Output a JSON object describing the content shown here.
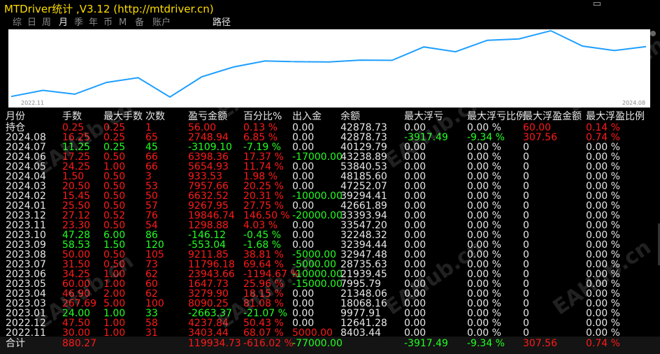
{
  "window": {
    "title": "MTDriver统计 ,V3.12 (http://mtdriver.cn)",
    "max_glyph": "▭"
  },
  "tabs": [
    {
      "label": "综"
    },
    {
      "label": "日"
    },
    {
      "label": "周"
    },
    {
      "label": "月"
    },
    {
      "label": "季"
    },
    {
      "label": "年"
    },
    {
      "label": "币"
    },
    {
      "label": "M"
    },
    {
      "label": "备"
    },
    {
      "label": "账户"
    }
  ],
  "active_tab": 3,
  "route_label": "路径",
  "chart": {
    "x_start": "2022.11",
    "x_end": "2024.08",
    "line_color": "#1e9fff",
    "values": [
      8403.44,
      12641.28,
      9977.91,
      18068.16,
      21348.06,
      7995.79,
      21939.45,
      28735.63,
      32947.48,
      32394.44,
      32248.32,
      33547.2,
      33393.94,
      42661.89,
      39294.41,
      47252.07,
      48185.6,
      53840.53,
      43238.89,
      40129.79,
      42878.73
    ]
  },
  "columns": [
    "月份",
    "手数",
    "最大手数",
    "次数",
    "盈亏金额",
    "百分比%",
    "出入金",
    "余额",
    "最大浮亏",
    "最大浮亏比例",
    "最大浮盈金额",
    "最大浮盈比例"
  ],
  "rows": [
    {
      "c": [
        "持仓",
        "0.25",
        "0.25",
        "1",
        "56.00",
        "0.13 %",
        "0.00",
        "42878.73",
        "0.00",
        "0.00 %",
        "60.00",
        "0.14 %"
      ],
      "t": [
        "w",
        "r",
        "r",
        "r",
        "r",
        "r",
        "w",
        "w",
        "w",
        "w",
        "r",
        "r"
      ]
    },
    {
      "c": [
        "2024.08",
        "16.25",
        "0.25",
        "65",
        "2748.94",
        "6.85 %",
        "0.00",
        "42878.73",
        "-3917.49",
        "-9.34 %",
        "307.56",
        "0.74 %"
      ],
      "t": [
        "w",
        "r",
        "r",
        "r",
        "r",
        "r",
        "w",
        "w",
        "g",
        "g",
        "r",
        "r"
      ]
    },
    {
      "c": [
        "2024.07",
        "11.25",
        "0.25",
        "45",
        "-3109.10",
        "-7.19 %",
        "0.00",
        "40129.79",
        "0.00",
        "0.00 %",
        "0",
        "0.00 %"
      ],
      "t": [
        "w",
        "g",
        "g",
        "g",
        "g",
        "g",
        "w",
        "w",
        "w",
        "w",
        "w",
        "w"
      ]
    },
    {
      "c": [
        "2024.06",
        "17.25",
        "0.50",
        "66",
        "6398.36",
        "17.37 %",
        "-17000.00",
        "43238.89",
        "0.00",
        "0.00 %",
        "0",
        "0.00 %"
      ],
      "t": [
        "w",
        "r",
        "r",
        "r",
        "r",
        "r",
        "g",
        "w",
        "w",
        "w",
        "w",
        "w"
      ]
    },
    {
      "c": [
        "2024.05",
        "24.25",
        "1.00",
        "66",
        "5654.93",
        "11.74 %",
        "0.00",
        "53840.53",
        "0.00",
        "0.00 %",
        "0",
        "0.00 %"
      ],
      "t": [
        "w",
        "r",
        "r",
        "r",
        "r",
        "r",
        "w",
        "w",
        "w",
        "w",
        "w",
        "w"
      ]
    },
    {
      "c": [
        "2024.04",
        "1.50",
        "0.50",
        "3",
        "933.53",
        "1.98 %",
        "0.00",
        "48185.60",
        "0.00",
        "0.00 %",
        "0",
        "0.00 %"
      ],
      "t": [
        "w",
        "r",
        "r",
        "r",
        "r",
        "r",
        "w",
        "w",
        "w",
        "w",
        "w",
        "w"
      ]
    },
    {
      "c": [
        "2024.03",
        "20.50",
        "0.50",
        "53",
        "7957.66",
        "20.25 %",
        "0.00",
        "47252.07",
        "0.00",
        "0.00 %",
        "0",
        "0.00 %"
      ],
      "t": [
        "w",
        "r",
        "r",
        "r",
        "r",
        "r",
        "w",
        "w",
        "w",
        "w",
        "w",
        "w"
      ]
    },
    {
      "c": [
        "2024.02",
        "15.45",
        "0.50",
        "50",
        "6632.52",
        "20.31 %",
        "-10000.00",
        "39294.41",
        "0.00",
        "0.00 %",
        "0",
        "0.00 %"
      ],
      "t": [
        "w",
        "r",
        "r",
        "r",
        "r",
        "r",
        "g",
        "w",
        "w",
        "w",
        "w",
        "w"
      ]
    },
    {
      "c": [
        "2024.01",
        "25.50",
        "0.50",
        "57",
        "9267.95",
        "27.75 %",
        "0.00",
        "42661.89",
        "0.00",
        "0.00 %",
        "0",
        "0.00 %"
      ],
      "t": [
        "w",
        "r",
        "r",
        "r",
        "r",
        "r",
        "w",
        "w",
        "w",
        "w",
        "w",
        "w"
      ]
    },
    {
      "c": [
        "2023.12",
        "27.12",
        "0.52",
        "76",
        "19846.74",
        "146.50 %",
        "-20000.00",
        "33393.94",
        "0.00",
        "0.00 %",
        "0",
        "0.00 %"
      ],
      "t": [
        "w",
        "r",
        "r",
        "r",
        "r",
        "r",
        "g",
        "w",
        "w",
        "w",
        "w",
        "w"
      ]
    },
    {
      "c": [
        "2023.11",
        "23.30",
        "0.50",
        "54",
        "1298.88",
        "4.03 %",
        "0.00",
        "33547.20",
        "0.00",
        "0.00 %",
        "0",
        "0.00 %"
      ],
      "t": [
        "w",
        "r",
        "r",
        "r",
        "r",
        "r",
        "w",
        "w",
        "w",
        "w",
        "w",
        "w"
      ]
    },
    {
      "c": [
        "2023.10",
        "47.28",
        "6.00",
        "86",
        "-146.12",
        "-0.45 %",
        "0.00",
        "32248.32",
        "0.00",
        "0.00 %",
        "0",
        "0.00 %"
      ],
      "t": [
        "w",
        "g",
        "g",
        "g",
        "g",
        "g",
        "w",
        "w",
        "w",
        "w",
        "w",
        "w"
      ]
    },
    {
      "c": [
        "2023.09",
        "58.53",
        "1.50",
        "120",
        "-553.04",
        "-1.68 %",
        "0.00",
        "32394.44",
        "0.00",
        "0.00 %",
        "0",
        "0.00 %"
      ],
      "t": [
        "w",
        "g",
        "g",
        "g",
        "g",
        "g",
        "w",
        "w",
        "w",
        "w",
        "w",
        "w"
      ]
    },
    {
      "c": [
        "2023.08",
        "50.00",
        "0.50",
        "105",
        "9211.85",
        "38.81 %",
        "-5000.00",
        "32947.48",
        "0.00",
        "0.00 %",
        "0",
        "0.00 %"
      ],
      "t": [
        "w",
        "r",
        "r",
        "r",
        "r",
        "r",
        "g",
        "w",
        "w",
        "w",
        "w",
        "w"
      ]
    },
    {
      "c": [
        "2023.07",
        "31.50",
        "0.50",
        "73",
        "11796.18",
        "69.64 %",
        "-5000.00",
        "28735.63",
        "0.00",
        "0.00 %",
        "0",
        "0.00 %"
      ],
      "t": [
        "w",
        "r",
        "r",
        "r",
        "r",
        "r",
        "g",
        "w",
        "w",
        "w",
        "w",
        "w"
      ]
    },
    {
      "c": [
        "2023.06",
        "34.25",
        "1.00",
        "62",
        "23943.66",
        "-1194.67 %",
        "-10000.00",
        "21939.45",
        "0.00",
        "0.00 %",
        "0",
        "0.00 %"
      ],
      "t": [
        "w",
        "r",
        "r",
        "r",
        "r",
        "r",
        "g",
        "w",
        "w",
        "w",
        "w",
        "w"
      ]
    },
    {
      "c": [
        "2023.05",
        "60.00",
        "1.00",
        "60",
        "1647.73",
        "25.96 %",
        "-15000.00",
        "7995.79",
        "0.00",
        "0.00 %",
        "0",
        "0.00 %"
      ],
      "t": [
        "w",
        "r",
        "r",
        "r",
        "r",
        "r",
        "g",
        "w",
        "w",
        "w",
        "w",
        "w"
      ]
    },
    {
      "c": [
        "2023.04",
        "46.90",
        "2.00",
        "62",
        "3279.90",
        "18.15 %",
        "0.00",
        "21348.06",
        "0.00",
        "0.00 %",
        "0",
        "0.00 %"
      ],
      "t": [
        "w",
        "r",
        "r",
        "r",
        "r",
        "r",
        "w",
        "w",
        "w",
        "w",
        "w",
        "w"
      ]
    },
    {
      "c": [
        "2023.03",
        "267.69",
        "5.00",
        "100",
        "8090.25",
        "81.08 %",
        "0.00",
        "18068.16",
        "0.00",
        "0.00 %",
        "0",
        "0.00 %"
      ],
      "t": [
        "w",
        "r",
        "r",
        "r",
        "r",
        "r",
        "w",
        "w",
        "w",
        "w",
        "w",
        "w"
      ]
    },
    {
      "c": [
        "2023.01",
        "24.00",
        "1.00",
        "33",
        "-2663.37",
        "-21.07 %",
        "0.00",
        "9977.91",
        "0.00",
        "0.00 %",
        "0",
        "0.00 %"
      ],
      "t": [
        "w",
        "g",
        "g",
        "g",
        "g",
        "g",
        "w",
        "w",
        "w",
        "w",
        "w",
        "w"
      ]
    },
    {
      "c": [
        "2022.12",
        "47.50",
        "1.00",
        "58",
        "4237.84",
        "50.43 %",
        "0.00",
        "12641.28",
        "0.00",
        "0.00 %",
        "0",
        "0.00 %"
      ],
      "t": [
        "w",
        "r",
        "r",
        "r",
        "r",
        "r",
        "w",
        "w",
        "w",
        "w",
        "w",
        "w"
      ]
    },
    {
      "c": [
        "2022.11",
        "30.00",
        "1.00",
        "31",
        "3403.44",
        "68.07 %",
        "5000.00",
        "8403.44",
        "0.00",
        "0.00 %",
        "0",
        "0.00 %"
      ],
      "t": [
        "w",
        "r",
        "r",
        "r",
        "r",
        "r",
        "r",
        "w",
        "w",
        "w",
        "w",
        "w"
      ]
    }
  ],
  "total": {
    "c": [
      "合计",
      "880.27",
      "",
      "",
      "119934.73",
      "-616.02 %",
      "-77000.00",
      "",
      "-3917.49",
      "-9.34 %",
      "307.56",
      "0.74 %"
    ],
    "t": [
      "w",
      "r",
      "w",
      "w",
      "r",
      "r",
      "g",
      "w",
      "g",
      "g",
      "r",
      "r"
    ]
  },
  "watermark": "EAHub.cn",
  "colors": {
    "profit": "#ff1a1a",
    "loss": "#22ff22",
    "text": "#e8e8e8",
    "title": "#ffdd00"
  }
}
